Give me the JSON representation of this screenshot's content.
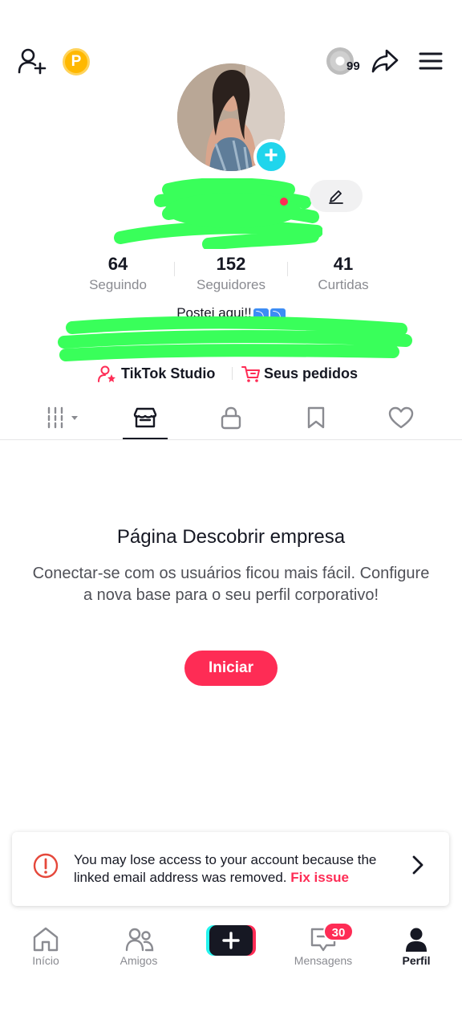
{
  "header": {
    "coin_letter": "P",
    "disc_count": "99"
  },
  "stats": [
    {
      "value": "64",
      "label": "Seguindo"
    },
    {
      "value": "152",
      "label": "Seguidores"
    },
    {
      "value": "41",
      "label": "Curtidas"
    }
  ],
  "bio": {
    "text": "Postei aqui!!"
  },
  "links": {
    "studio": "TikTok Studio",
    "orders": "Seus pedidos"
  },
  "empty_state": {
    "title": "Página Descobrir empresa",
    "body": "Conectar-se com os usuários ficou mais fácil. Configure a nova base para o seu perfil corporativo!",
    "button": "Iniciar"
  },
  "warning": {
    "message": "You may lose access to your account because the linked email address was removed.",
    "action": "Fix issue"
  },
  "bottom_nav": {
    "home": "Início",
    "friends": "Amigos",
    "messages": "Mensagens",
    "messages_badge": "30",
    "profile": "Perfil"
  },
  "colors": {
    "accent": "#fe2c55",
    "cyan": "#20d5ec",
    "text": "#161823",
    "muted": "#8a8b91",
    "redaction_green": "#39ff5a"
  },
  "icons": [
    "add-user-icon",
    "coin-icon",
    "music-disc-icon",
    "share-icon",
    "menu-icon",
    "edit-icon",
    "grid-icon",
    "shop-icon",
    "lock-icon",
    "bookmark-icon",
    "heart-icon",
    "alert-icon",
    "chevron-right-icon",
    "home-icon",
    "friends-icon",
    "plus-icon",
    "inbox-icon",
    "profile-icon",
    "studio-icon",
    "cart-icon"
  ]
}
